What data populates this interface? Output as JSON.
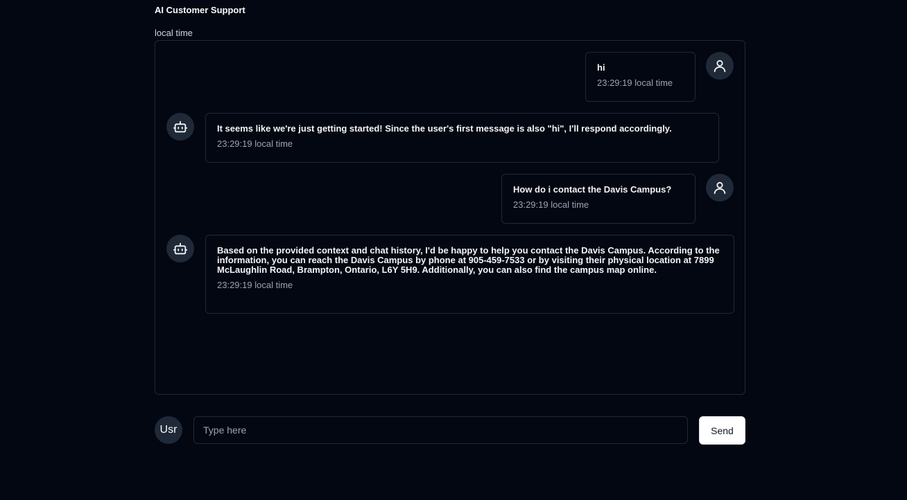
{
  "header": {
    "title": "AI Customer Support",
    "timezone_label": "local time"
  },
  "messages": [
    {
      "role": "user",
      "text": "hi",
      "time": "23:29:19 local time"
    },
    {
      "role": "bot",
      "text": "It seems like we're just getting started! Since the user's first message is also \"hi\", I'll respond accordingly.",
      "time": "23:29:19 local time"
    },
    {
      "role": "user",
      "text": "How do i contact the Davis Campus?",
      "time": "23:29:19 local time"
    },
    {
      "role": "bot",
      "text": "Based on the provided context and chat history, I'd be happy to help you contact the Davis Campus. According to the information, you can reach the Davis Campus by phone at 905-459-7533 or by visiting their physical location at 7899 McLaughlin Road, Brampton, Ontario, L6Y 5H9. Additionally, you can also find the campus map online.",
      "time": "23:29:19 local time"
    }
  ],
  "composer": {
    "avatar_label": "Usr",
    "placeholder": "Type here",
    "value": "",
    "send_label": "Send"
  },
  "icons": {
    "user": "user-icon",
    "bot": "bot-icon"
  },
  "colors": {
    "background": "#030712",
    "border": "#1f2937",
    "avatar_bg": "#1f2937",
    "button_bg": "#ffffff"
  }
}
